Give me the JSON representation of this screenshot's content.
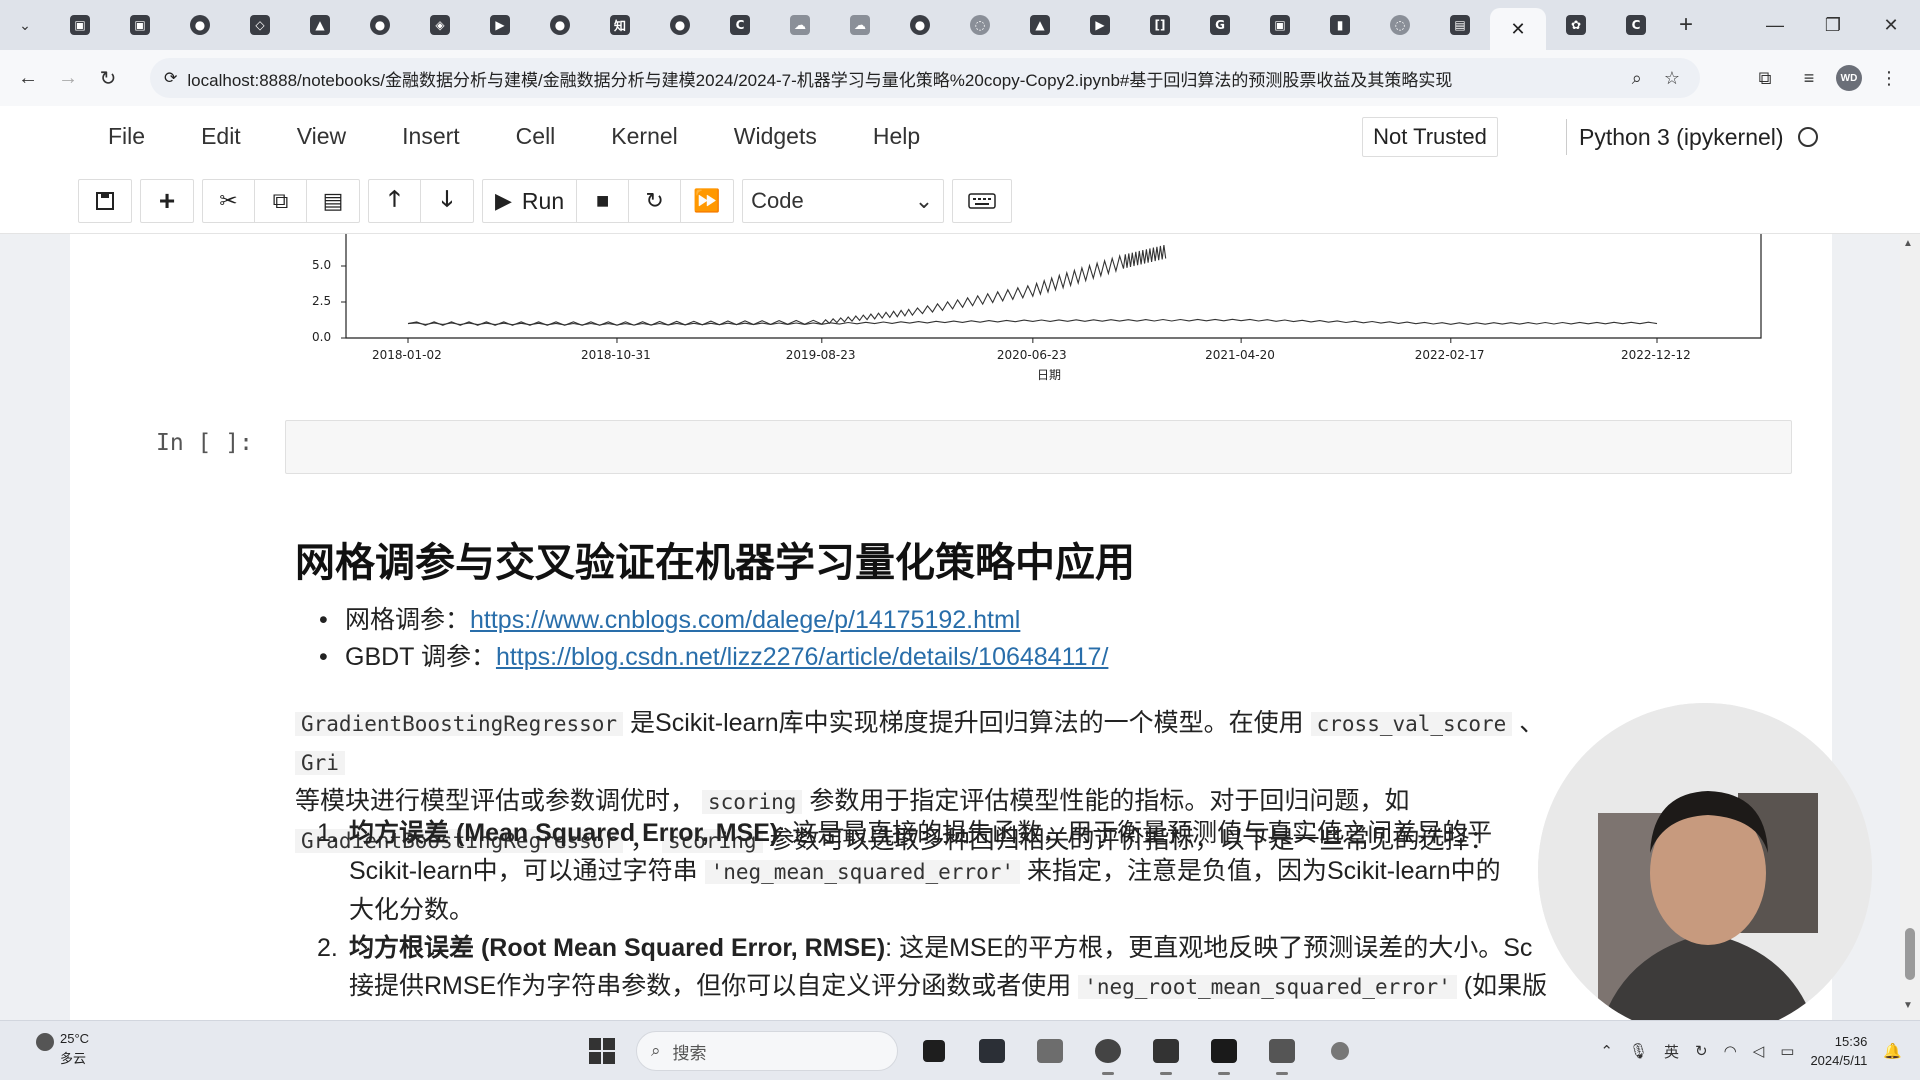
{
  "browser": {
    "tabs": [
      {
        "icon": "bilibili-icon",
        "glyph": "▣"
      },
      {
        "icon": "bilibili-icon",
        "glyph": "▣"
      },
      {
        "icon": "github-icon",
        "glyph": "●"
      },
      {
        "icon": "script-icon",
        "glyph": "◇"
      },
      {
        "icon": "tool-icon",
        "glyph": "▲"
      },
      {
        "icon": "github-icon",
        "glyph": "●"
      },
      {
        "icon": "cube-icon",
        "glyph": "◈"
      },
      {
        "icon": "video-icon",
        "glyph": "▶"
      },
      {
        "icon": "github-icon",
        "glyph": "●"
      },
      {
        "icon": "zhihu-icon",
        "glyph": "知"
      },
      {
        "icon": "github-icon",
        "glyph": "●"
      },
      {
        "icon": "c-icon",
        "glyph": "C"
      },
      {
        "icon": "cloud-icon",
        "glyph": "☁"
      },
      {
        "icon": "cloud-icon",
        "glyph": "☁"
      },
      {
        "icon": "github-icon",
        "glyph": "●"
      },
      {
        "icon": "loading-icon",
        "glyph": "◌"
      },
      {
        "icon": "graduation-icon",
        "glyph": "▲"
      },
      {
        "icon": "youtube-icon",
        "glyph": "▶"
      },
      {
        "icon": "bracket-icon",
        "glyph": "[]"
      },
      {
        "icon": "google-icon",
        "glyph": "G"
      },
      {
        "icon": "bilibili-icon",
        "glyph": "▣"
      },
      {
        "icon": "chart-icon",
        "glyph": "▮"
      },
      {
        "icon": "loading-icon",
        "glyph": "◌"
      },
      {
        "icon": "book-icon",
        "glyph": "▤"
      }
    ],
    "active_tab_close": "✕",
    "after_tabs": [
      {
        "icon": "paw-icon",
        "glyph": "✿"
      },
      {
        "icon": "c-icon",
        "glyph": "C"
      }
    ],
    "new_tab": "+",
    "url": "localhost:8888/notebooks/金融数据分析与建模/金融数据分析与建模2024/2024-7-机器学习与量化策略%20copy-Copy2.ipynb#基于回归算法的预测股票收益及其策略实现",
    "avatar_text": "WD"
  },
  "jupyter": {
    "menu": [
      "File",
      "Edit",
      "View",
      "Insert",
      "Cell",
      "Kernel",
      "Widgets",
      "Help"
    ],
    "trust_label": "Not Trusted",
    "kernel_label": "Python 3 (ipykernel)",
    "run_label": "Run",
    "cell_type": "Code"
  },
  "chart_data": {
    "type": "line",
    "xlabel": "日期",
    "x_ticks": [
      "2018-01-02",
      "2018-10-31",
      "2019-08-23",
      "2020-06-23",
      "2021-04-20",
      "2022-02-17",
      "2022-12-12"
    ],
    "y_ticks": [
      "0.0",
      "2.5",
      "5.0"
    ],
    "ylim_visible": [
      0,
      5
    ],
    "series": [
      {
        "x": [
          "2018-01-02",
          "2018-10-31",
          "2019-08-23",
          "2020-01-01",
          "2020-06-23",
          "2020-11-01",
          "2021-01-01"
        ],
        "values": [
          1.0,
          1.0,
          1.1,
          1.8,
          3.3,
          5.3,
          6.0
        ]
      },
      {
        "x": [
          "2018-01-02",
          "2018-10-31",
          "2019-08-23",
          "2020-06-23",
          "2021-04-20",
          "2022-02-17",
          "2022-12-12"
        ],
        "values": [
          1.0,
          0.95,
          1.0,
          1.2,
          1.25,
          1.0,
          1.05
        ]
      }
    ]
  },
  "cell": {
    "prompt": "In  [  ]:"
  },
  "markdown": {
    "heading": "网格调参与交叉验证在机器学习量化策略中应用",
    "links": [
      {
        "label": "网格调参：",
        "url": "https://www.cnblogs.com/dalege/p/14175192.html"
      },
      {
        "label": "GBDT 调参：",
        "url": "https://blog.csdn.net/lizz2276/article/details/106484117/"
      }
    ],
    "para": {
      "code1": "GradientBoostingRegressor",
      "t1": " 是Scikit-learn库中实现梯度提升回归算法的一个模型。在使用 ",
      "code2": "cross_val_score",
      "t2": " 、 ",
      "code3": "Gri",
      "t3": "等模块进行模型评估或参数调优时， ",
      "code4": "scoring",
      "t4": " 参数用于指定评估模型性能的指标。对于回归问题，如",
      "code5": "GradientBoostingRegressor",
      "t5": " ， ",
      "code6": "scoring",
      "t6": " 参数可以选取多种回归相关的评价指标，以下是一些常见的选择："
    },
    "items": [
      {
        "num": "1.",
        "bold": "均方误差 (Mean Squared Error, MSE)",
        "t1": ": 这是最直接的损失函数，用于衡量预测值与真实值之间差异的平",
        "t2": "Scikit-learn中，可以通过字符串 ",
        "code": "'neg_mean_squared_error'",
        "t3": " 来指定，注意是负值，因为Scikit-learn中的",
        "t4": "大化分数。"
      },
      {
        "num": "2.",
        "bold": "均方根误差 (Root Mean Squared Error, RMSE)",
        "t1": ": 这是MSE的平方根，更直观地反映了预测误差的大小。Sc",
        "t2": "接提供RMSE作为字符串参数，但你可以自定义评分函数或者使用 ",
        "code": "'neg_root_mean_squared_error'",
        "t3": " (如果版"
      }
    ]
  },
  "taskbar": {
    "temperature": "25°C",
    "weather": "多云",
    "search_placeholder": "搜索",
    "time": "15:36",
    "date": "2024/5/11"
  }
}
